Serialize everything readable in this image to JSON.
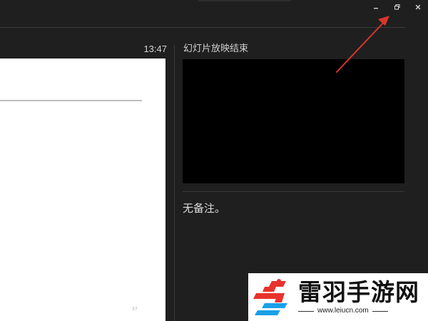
{
  "window": {
    "minimize_label": "Minimize",
    "restore_label": "Restore",
    "close_label": "Close"
  },
  "presenter": {
    "clock": "13:47",
    "next_slide_label": "幻灯片放映结束",
    "notes": "无备注。",
    "current_slide_number": "37"
  },
  "annotation": {
    "arrow_color": "#d9362b"
  },
  "watermark": {
    "name": "雷羽手游网",
    "url": "www.leiucn.com",
    "logo_colors": {
      "red": "#e8322c",
      "blue": "#1aa0e8"
    }
  }
}
